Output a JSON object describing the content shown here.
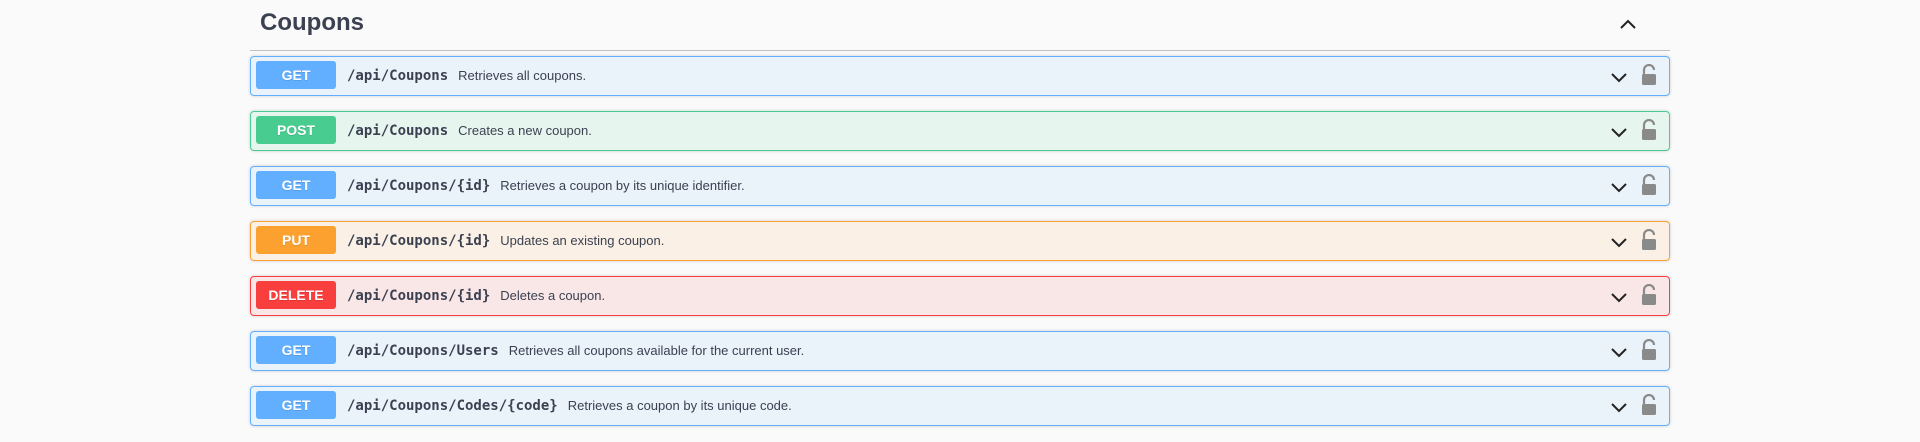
{
  "tag": {
    "title": "Coupons"
  },
  "operations": [
    {
      "method": "GET",
      "path": "/api/Coupons",
      "summary": "Retrieves all coupons."
    },
    {
      "method": "POST",
      "path": "/api/Coupons",
      "summary": "Creates a new coupon."
    },
    {
      "method": "GET",
      "path": "/api/Coupons/{id}",
      "summary": "Retrieves a coupon by its unique identifier."
    },
    {
      "method": "PUT",
      "path": "/api/Coupons/{id}",
      "summary": "Updates an existing coupon."
    },
    {
      "method": "DELETE",
      "path": "/api/Coupons/{id}",
      "summary": "Deletes a coupon."
    },
    {
      "method": "GET",
      "path": "/api/Coupons/Users",
      "summary": "Retrieves all coupons available for the current user."
    },
    {
      "method": "GET",
      "path": "/api/Coupons/Codes/{code}",
      "summary": "Retrieves a coupon by its unique code."
    }
  ],
  "colors": {
    "get": "#61affe",
    "post": "#49cc90",
    "put": "#fca130",
    "delete": "#f93e3e",
    "text": "#3b4151"
  },
  "icons": {
    "collapse": "chevron-up-icon",
    "expand": "chevron-down-icon",
    "lock": "unlocked-padlock-icon"
  }
}
